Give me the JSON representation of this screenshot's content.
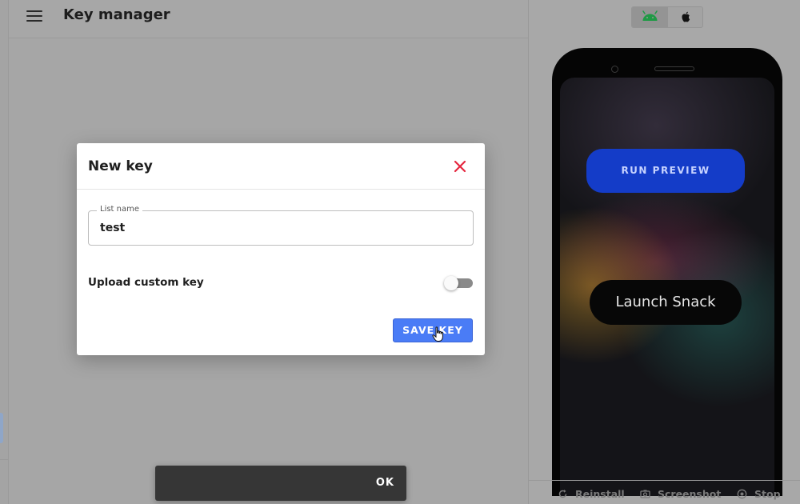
{
  "header": {
    "title": "Key manager",
    "menu_icon": "hamburger-menu-icon"
  },
  "modal": {
    "title": "New key",
    "close_icon": "close-icon",
    "close_color": "#e5263f",
    "list_name_label": "List name",
    "list_name_value": "test",
    "upload_label": "Upload custom key",
    "upload_enabled": false,
    "save_label": "SAVE KEY",
    "save_color": "#4a7cf6"
  },
  "snackbar": {
    "action_label": "OK"
  },
  "preview": {
    "platforms": [
      {
        "name": "android",
        "icon": "android-icon",
        "selected": true
      },
      {
        "name": "ios",
        "icon": "apple-icon",
        "selected": false
      }
    ],
    "run_label": "RUN PREVIEW",
    "launch_label": "Launch Snack",
    "footer": {
      "reinstall": "Reinstall",
      "screenshot": "Screenshot",
      "stop": "Stop"
    }
  }
}
